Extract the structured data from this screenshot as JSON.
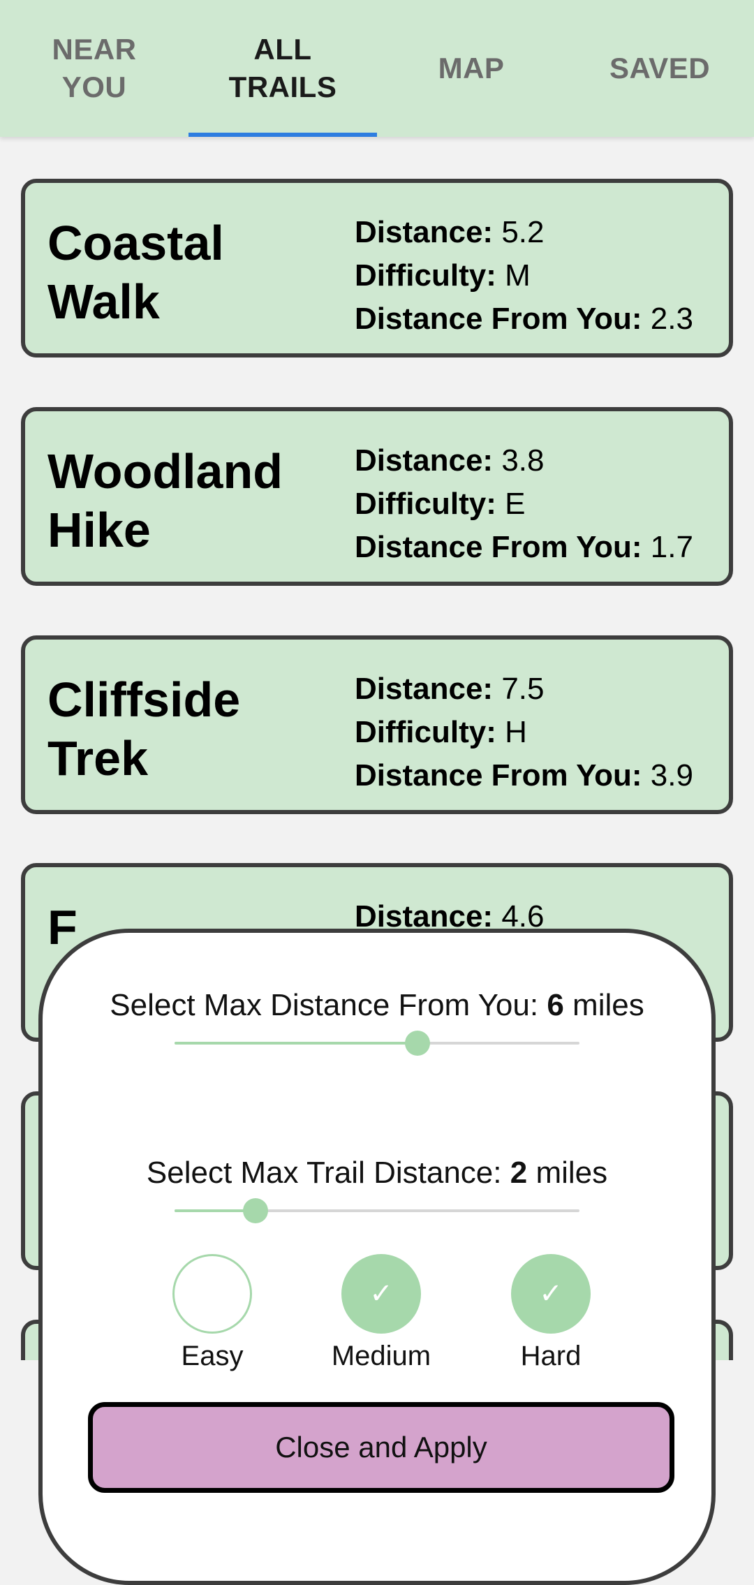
{
  "tabs": [
    {
      "label": "NEAR\nYOU",
      "active": false
    },
    {
      "label": "ALL\nTRAILS",
      "active": true
    },
    {
      "label": "MAP",
      "active": false
    },
    {
      "label": "SAVED",
      "active": false
    }
  ],
  "trails": [
    {
      "name": "Coastal\nWalk",
      "distance_label": "Distance:",
      "distance": "5.2",
      "difficulty_label": "Difficulty:",
      "difficulty": "M",
      "from_label": "Distance From You:",
      "from": "2.3"
    },
    {
      "name": "Woodland\nHike",
      "distance_label": "Distance:",
      "distance": "3.8",
      "difficulty_label": "Difficulty:",
      "difficulty": "E",
      "from_label": "Distance From You:",
      "from": "1.7"
    },
    {
      "name": "Cliffside\nTrek",
      "distance_label": "Distance:",
      "distance": "7.5",
      "difficulty_label": "Difficulty:",
      "difficulty": "H",
      "from_label": "Distance From You:",
      "from": "3.9"
    },
    {
      "name": "F",
      "distance_label": "Distance:",
      "distance": "4.6"
    }
  ],
  "filter": {
    "max_from_label": "Select Max Distance From You: ",
    "max_from_value": "6",
    "max_from_unit": " miles",
    "max_from_fraction": 0.6,
    "max_trail_label": "Select Max Trail Distance: ",
    "max_trail_value": "2",
    "max_trail_unit": " miles",
    "max_trail_fraction": 0.2,
    "difficulty_options": [
      {
        "label": "Easy",
        "checked": false
      },
      {
        "label": "Medium",
        "checked": true
      },
      {
        "label": "Hard",
        "checked": true
      }
    ],
    "apply_label": "Close and Apply"
  },
  "colors": {
    "tab_bg": "#cfe8d1",
    "card_bg": "#cfe8d1",
    "accent_underline": "#2e7de0",
    "slider": "#a6d8ab",
    "apply_bg": "#d4a3cc"
  }
}
